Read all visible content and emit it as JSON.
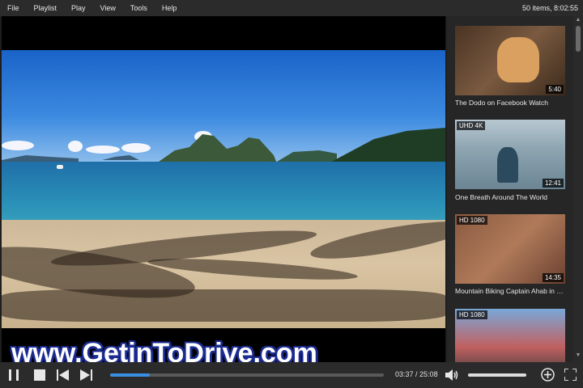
{
  "menu": {
    "items": [
      "File",
      "Playlist",
      "Play",
      "View",
      "Tools",
      "Help"
    ],
    "status": "50 items, 8:02:55"
  },
  "playlist": {
    "items": [
      {
        "title": "The Dodo on Facebook Watch",
        "duration": "5:40",
        "badge": ""
      },
      {
        "title": "One Breath Around The World",
        "duration": "12:41",
        "badge": "UHD 4K"
      },
      {
        "title": "Mountain Biking Captain Ahab in Moab",
        "duration": "14:35",
        "badge": "HD 1080"
      },
      {
        "title": "",
        "duration": "",
        "badge": "HD 1080"
      }
    ]
  },
  "player": {
    "current_time": "03:37",
    "total_time": "25:08",
    "time_separator": " / ",
    "progress_fraction": 0.144,
    "volume_fraction": 1.0
  },
  "watermark": "www.GetinToDrive.com",
  "colors": {
    "accent": "#3b8fe0",
    "background": "#1e1e1e",
    "menubar": "#2b2b2b",
    "watermark_outline": "#1b2b8f"
  },
  "icons": [
    "pause-icon",
    "stop-icon",
    "previous-icon",
    "next-icon",
    "volume-icon",
    "add-icon",
    "fullscreen-icon"
  ]
}
